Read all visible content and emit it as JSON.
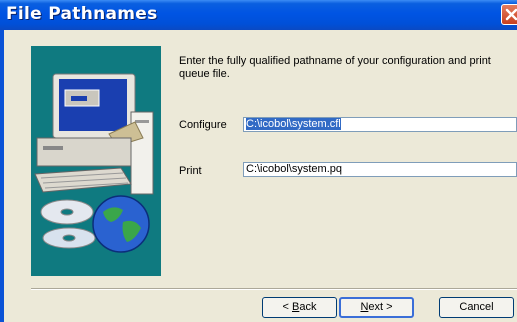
{
  "window": {
    "title": "File Pathnames"
  },
  "instructions": "Enter the fully qualified pathname of your configuration and print queue file.",
  "fields": {
    "configure": {
      "label": "Configure",
      "value": "C:\\icobol\\system.cfl"
    },
    "print": {
      "label": "Print",
      "value": "C:\\icobol\\system.pq"
    }
  },
  "buttons": {
    "back": {
      "prefix": "< ",
      "mnemonic": "B",
      "rest": "ack"
    },
    "next": {
      "mnemonic": "N",
      "rest": "ext >"
    },
    "cancel": "Cancel"
  },
  "icons": [
    "computer-illustration",
    "cd-disc-icon",
    "globe-icon",
    "close-icon"
  ],
  "colors": {
    "titlebar": "#0054e3",
    "art_panel": "#0f7a80",
    "selection": "#316ac5"
  }
}
